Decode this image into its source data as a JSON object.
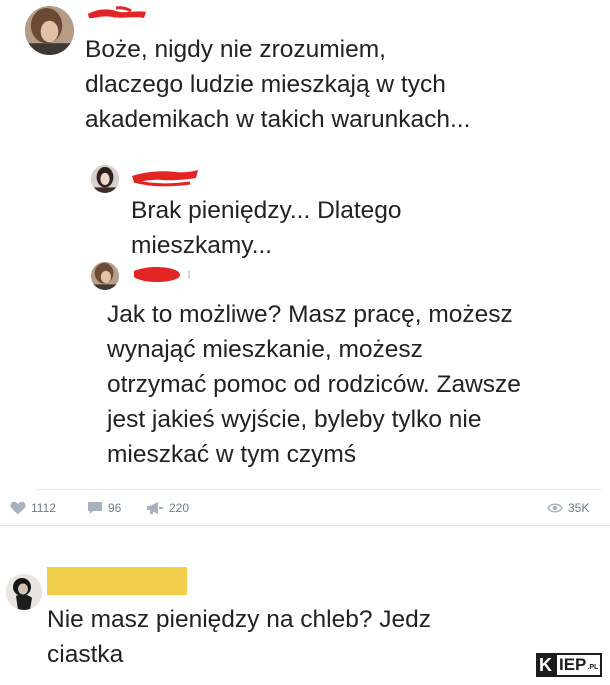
{
  "post": {
    "text_lines": [
      "Boże, nigdy nie zrozumiem,",
      "dlaczego ludzie mieszkają w tych",
      "akademikach w takich warunkach..."
    ]
  },
  "reply_1": {
    "text_lines": [
      "Brak pieniędzy... Dlatego",
      "mieszkamy..."
    ]
  },
  "reply_2": {
    "text_lines": [
      "Jak to możliwe? Masz pracę, możesz",
      "wynająć mieszkanie, możesz",
      "otrzymać pomoc od rodziców. Zawsze",
      "jest jakieś wyjście, byleby tylko nie",
      "mieszkać w tym czymś"
    ]
  },
  "stats": {
    "likes": "1112",
    "comments": "96",
    "reposts": "220",
    "views": "35K",
    "icon_color": "#a6b2bd"
  },
  "bottom_comment": {
    "text_lines": [
      "Nie masz pieniędzy na chleb? Jedz",
      "ciastka"
    ],
    "redaction_color": "#f2cf4a"
  },
  "watermark": {
    "k": "K",
    "rest": "IEP",
    "suffix": ".PL"
  },
  "colors": {
    "redaction_red": "#e32424",
    "text": "#222222",
    "stat_text": "#6f7c88"
  }
}
